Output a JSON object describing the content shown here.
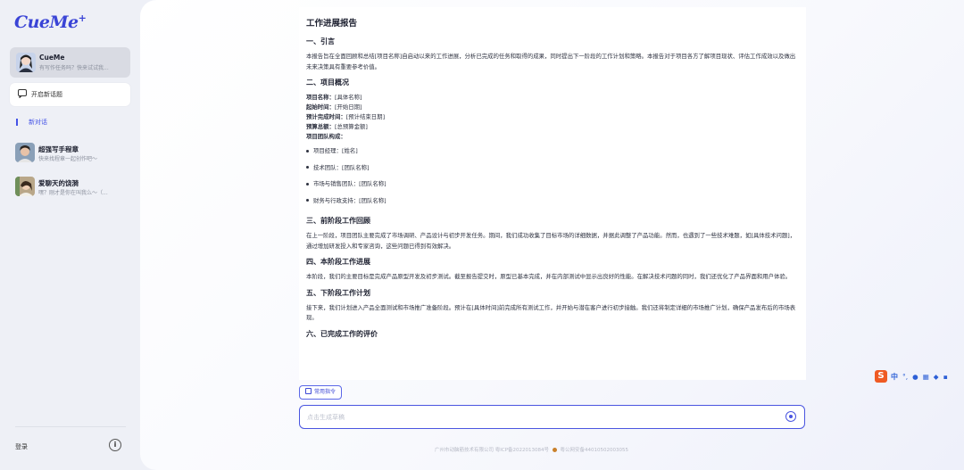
{
  "sidebar": {
    "logo": "CueMe",
    "logo_plus": "+",
    "active_bot": {
      "name": "CueMe",
      "desc": "有写作任务吗？快来试试我..."
    },
    "new_topic_label": "开启新话题",
    "new_chat_label": "新对话",
    "bots": [
      {
        "name": "超强写手程章",
        "desc": "快来找程章一起创作吧～"
      },
      {
        "name": "爱聊天的饶漪",
        "desc": "嘿？刚才是你在叫我么～（..."
      }
    ],
    "login_label": "登录",
    "info_label": "i"
  },
  "report": {
    "title": "工作进展报告",
    "s1_heading": "一、引言",
    "s1_text": "本报告旨在全面回顾和总结[项目名称]自启动以来的工作进展，分析已完成的任务和取得的成果，同时提出下一阶段的工作计划和策略。本报告对于项目各方了解项目现状、评估工作成效以及做出未来决策具有重要参考价值。",
    "s2_heading": "二、项目概况",
    "fields": [
      {
        "label": "项目名称：",
        "value": "[具体名称]"
      },
      {
        "label": "起始时间：",
        "value": "[开始日期]"
      },
      {
        "label": "预计完成时间：",
        "value": "[预计结束日期]"
      },
      {
        "label": "预算总额：",
        "value": "[总预算金额]"
      },
      {
        "label": "项目团队构成：",
        "value": ""
      }
    ],
    "team": [
      "项目经理：[姓名]",
      "技术团队：[团队名称]",
      "市场与销售团队：[团队名称]",
      "财务与行政支持：[团队名称]"
    ],
    "s3_heading": "三、前阶段工作回顾",
    "s3_text": "在上一阶段，项目团队主要完成了市场调研、产品设计与初步开发任务。期间，我们成功收集了目标市场的详细数据，并据此调整了产品功能。然而，也遇到了一些技术难题，如[具体技术问题]，通过增加研发投入和专家咨询，这些问题已得到有效解决。",
    "s4_heading": "四、本阶段工作进展",
    "s4_text": "本阶段，我们的主要目标是完成产品原型开发及初步测试。截至报告提交时，原型已基本完成，并在内部测试中显示出良好的性能。在解决技术问题的同时，我们还优化了产品界面和用户体验。",
    "s5_heading": "五、下阶段工作计划",
    "s5_text": "接下来，我们计划进入产品全面测试和市场推广准备阶段。预计在[具体时间]前完成所有测试工作，并开始与潜在客户进行初步接触。我们还将制定详细的市场推广计划，确保产品发布后的市场表现。",
    "s6_heading": "六、已完成工作的评价"
  },
  "composer": {
    "common_cmd_label": "常用指令",
    "input_placeholder": "点击生成草稿"
  },
  "footer": {
    "company": "广州市动脑筋技术有限公司 粤ICP备2022013084号",
    "police": "粤公网安备44010502003055"
  },
  "ime": {
    "logo": "S",
    "lang": "中"
  },
  "colors": {
    "accent": "#4a55e0",
    "sidebar_bg": "#eef0f6"
  }
}
